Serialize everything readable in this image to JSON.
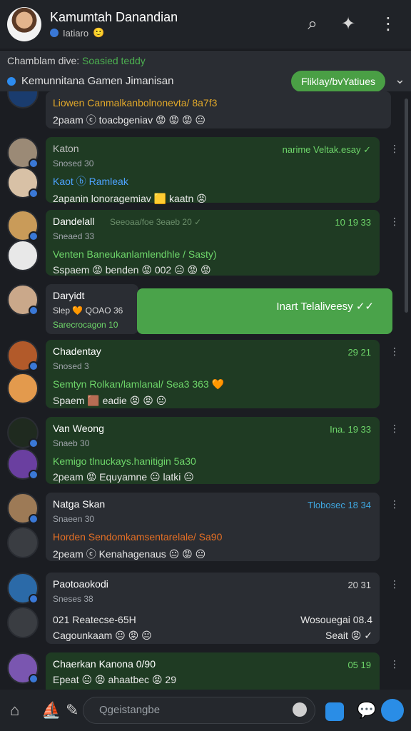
{
  "header": {
    "title": "Kamumtah Danandian",
    "subtitle": "Iatiaro",
    "icons": [
      "search-icon",
      "puzzle-icon",
      "more-icon"
    ]
  },
  "channel": {
    "line1_prefix": "Chamblam dive:",
    "line1_accent": "Soasied teddy",
    "line2": "Kemunnitana Gamen Jimanisan",
    "button": "Fliklay/bvYatiues"
  },
  "messages": [
    {
      "text": "Liowen Canmalkanbolnonevta/ 8a7f3",
      "reactions": "2paam ⓒ toacbgeniav 😡 😡 😡   😐"
    },
    {
      "name": "Katon",
      "meta": "Snosed 30",
      "subname": "Kaot ⓑ Ramleak",
      "reactions": "2apanin lonoragemiav 🟨 kaatn 😡",
      "time": "narime Veltak.esay ✓"
    },
    {
      "name": "Dandelall",
      "meta": "Sneaed 33",
      "inline": "Seeoaa/foe 3eaeb 20 ✓",
      "time": "10   19 33",
      "text": "Venten Baneukanlamlendhle / Sasty)",
      "reactions": "Sspaem 😡 benden 😡 002 😐 😡 😡"
    },
    {
      "name": "Daryidt",
      "meta": "Slep 🧡 QOAO 36",
      "meta2": "Sarecrocagon  10",
      "sent": "Inart Telaliveesy ✓✓"
    },
    {
      "name": "Chadentay",
      "meta": "Snosed 3",
      "time": "29 21",
      "text": "Semtyn Rolkan/lamlanal/ Sea3 363 🧡",
      "reactions": "Spaem 🟫 eadie 😡 😡 😐"
    },
    {
      "name": "Van Weong",
      "meta": "Snaeb 30",
      "time": "Ina.  19 33",
      "text": "Kemigo tlnuckays.hanitigin 5a30",
      "reactions": "2peam 😡 Equyamne 😐 latki 😐"
    },
    {
      "name": "Natga Skan",
      "meta": "Snaeen 30",
      "time": "Tlobosec 18 34",
      "text": "Horden Sendomkamsentarelale/ Sa90",
      "reactions": "2peam ⓒ Kenahagenaus 😐 😡 😐"
    },
    {
      "name": "Paotoaokodi",
      "meta": "Sneses 38",
      "time": "20 31",
      "line": "021 Reatecse-65H",
      "line_right": "Wosouegai 08.4",
      "reactions": "Cagounkaam 😐 😡 😐",
      "reactions_right": "Seait 😡 ✓"
    },
    {
      "name": "Chaerkan Kanona 0/90",
      "time": "05 19",
      "reactions": "Epeat 😐 😡 ahaatbec 😡 29"
    }
  ],
  "footer": {
    "search_placeholder": "Qgeistangbe"
  },
  "colors": {
    "bubble_green": "#1f3b23",
    "accent_green": "#4aa34a",
    "accent_blue": "#2a8de6"
  }
}
